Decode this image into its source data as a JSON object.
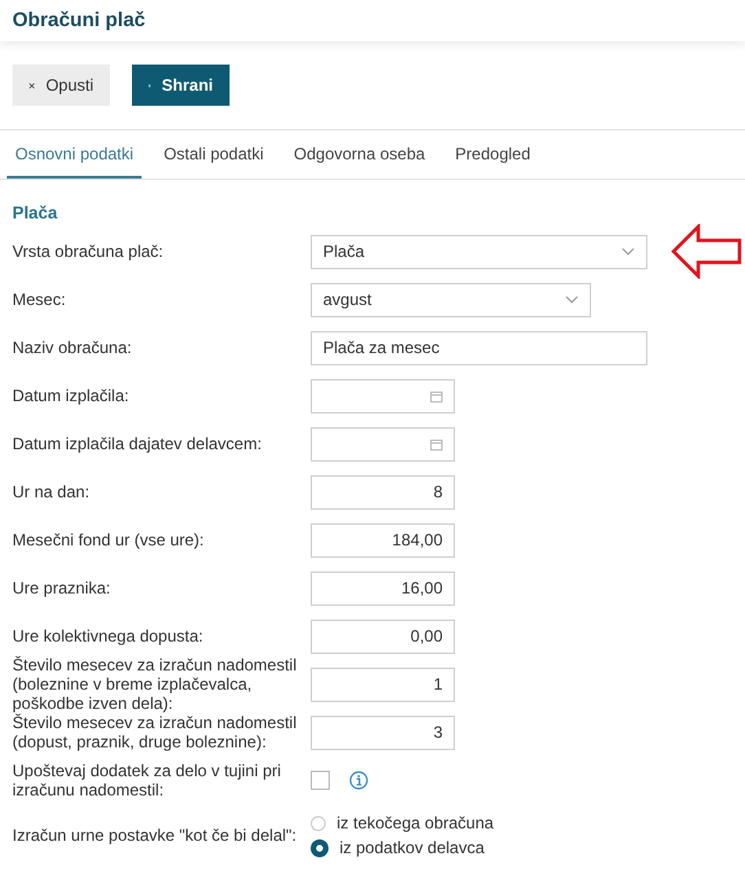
{
  "page_title": "Obračuni plač",
  "toolbar": [
    {
      "kind": "cancel",
      "label": "Opusti"
    },
    {
      "kind": "save",
      "label": "Shrani"
    }
  ],
  "tabs": [
    {
      "label": "Osnovni podatki",
      "selected": true
    },
    {
      "label": "Ostali podatki",
      "selected": false
    },
    {
      "label": "Odgovorna oseba",
      "selected": false
    },
    {
      "label": "Predogled",
      "selected": false
    }
  ],
  "section_title": "Plača",
  "fields": [
    {
      "kind": "select",
      "label": "Vrsta obračuna plač:",
      "value": "Plača",
      "highlighted": true
    },
    {
      "kind": "select",
      "label": "Mesec:",
      "value": "avgust"
    },
    {
      "kind": "text",
      "label": "Naziv obračuna:",
      "value": "Plača za mesec"
    },
    {
      "kind": "date",
      "label": "Datum izplačila:"
    },
    {
      "kind": "date",
      "label": "Datum izplačila dajatev delavcem:"
    },
    {
      "kind": "number",
      "label": "Ur na dan:",
      "value": "8"
    },
    {
      "kind": "number",
      "label": "Mesečni fond ur (vse ure):",
      "value": "184,00"
    },
    {
      "kind": "number",
      "label": "Ure praznika:",
      "value": "16,00"
    },
    {
      "kind": "number",
      "label": "Ure kolektivnega dopusta:",
      "value": "0,00"
    },
    {
      "kind": "number",
      "label": "Število mesecev za izračun nadomestil (boleznine v breme izplačevalca, poškodbe izven dela):",
      "value": "1"
    },
    {
      "kind": "number",
      "label": "Število mesecev za izračun nadomestil (dopust, praznik, druge boleznine):",
      "value": "3"
    },
    {
      "kind": "checkbox",
      "label": "Upoštevaj dodatek za delo v tujini pri izračunu nadomestil:",
      "checked": false,
      "info": true
    },
    {
      "kind": "radio",
      "label": "Izračun urne postavke \"kot če bi delal\":",
      "options": [
        {
          "label": "iz tekočega obračuna",
          "selected": false
        },
        {
          "label": "iz podatkov delavca",
          "selected": true
        }
      ]
    }
  ]
}
